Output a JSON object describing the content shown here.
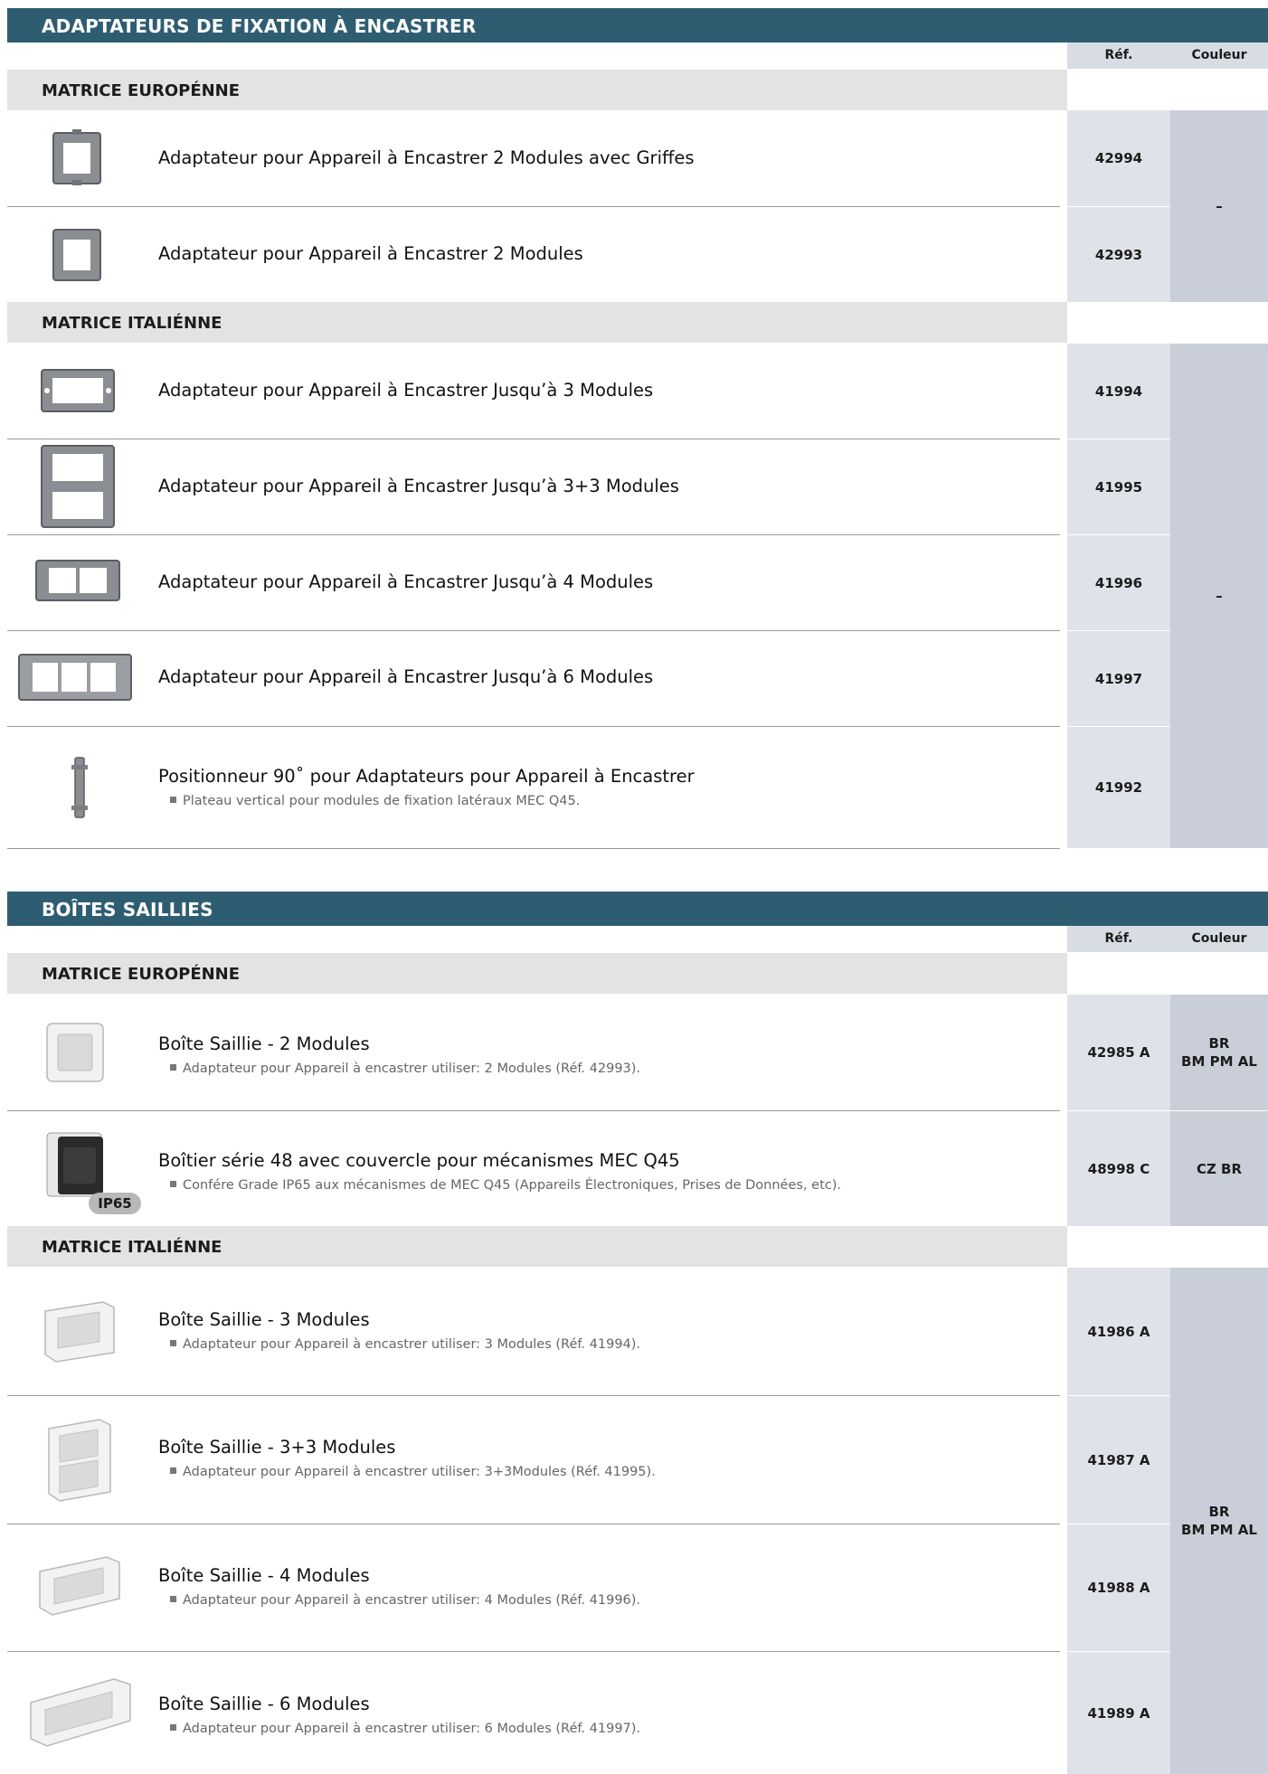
{
  "section1": {
    "title": "ADAPTATEURS DE FIXATION À ENCASTRER",
    "col_ref": "Réf.",
    "col_color": "Couleur",
    "group_eu": {
      "label": "MATRICE EUROPÉNNE",
      "color": "–",
      "rows": [
        {
          "title": "Adaptateur pour Appareil à Encastrer 2 Modules avec Griffes",
          "ref": "42994"
        },
        {
          "title": "Adaptateur pour Appareil à Encastrer 2 Modules",
          "ref": "42993"
        }
      ]
    },
    "group_it": {
      "label": "MATRICE ITALIÉNNE",
      "color": "–",
      "rows": [
        {
          "title": "Adaptateur pour Appareil à Encastrer Jusqu’à 3 Modules",
          "ref": "41994"
        },
        {
          "title": "Adaptateur pour Appareil à Encastrer Jusqu’à 3+3 Modules",
          "ref": "41995"
        },
        {
          "title": "Adaptateur pour Appareil à Encastrer Jusqu’à 4 Modules",
          "ref": "41996"
        },
        {
          "title": "Adaptateur pour Appareil à Encastrer Jusqu’à 6 Modules",
          "ref": "41997"
        },
        {
          "title": "Positionneur 90˚ pour Adaptateurs pour Appareil à Encastrer",
          "note": "Plateau vertical pour modules de fixation latéraux MEC Q45.",
          "ref": "41992"
        }
      ]
    }
  },
  "section2": {
    "title": "BOÎTES SAILLIES",
    "col_ref": "Réf.",
    "col_color": "Couleur",
    "group_eu": {
      "label": "MATRICE EUROPÉNNE",
      "rows": [
        {
          "title": "Boîte Saillie - 2 Modules",
          "note": "Adaptateur pour Appareil à encastrer utiliser: 2 Modules (Réf. 42993).",
          "ref": "42985 A",
          "color": "BR\nBM PM AL"
        },
        {
          "title": "Boîtier série 48 avec couvercle pour mécanismes MEC Q45",
          "note": "Confére Grade IP65 aux mécanismes de MEC Q45 (Appareils Électroniques, Prises de Données, etc).",
          "ref": "48998 C",
          "color": "CZ BR",
          "badge": "IP65"
        }
      ]
    },
    "group_it": {
      "label": "MATRICE ITALIÉNNE",
      "color": "BR\nBM PM AL",
      "rows": [
        {
          "title": "Boîte Saillie - 3 Modules",
          "note": "Adaptateur pour Appareil à encastrer utiliser: 3 Modules (Réf. 41994).",
          "ref": "41986 A"
        },
        {
          "title": "Boîte Saillie - 3+3 Modules",
          "note": "Adaptateur pour Appareil à encastrer utiliser: 3+3Modules (Réf. 41995).",
          "ref": "41987 A"
        },
        {
          "title": "Boîte Saillie - 4 Modules",
          "note": "Adaptateur pour Appareil à encastrer utiliser: 4 Modules (Réf. 41996).",
          "ref": "41988 A"
        },
        {
          "title": "Boîte Saillie - 6 Modules",
          "note": "Adaptateur pour Appareil à encastrer utiliser: 6 Modules (Réf. 41997).",
          "ref": "41989 A"
        }
      ]
    }
  }
}
